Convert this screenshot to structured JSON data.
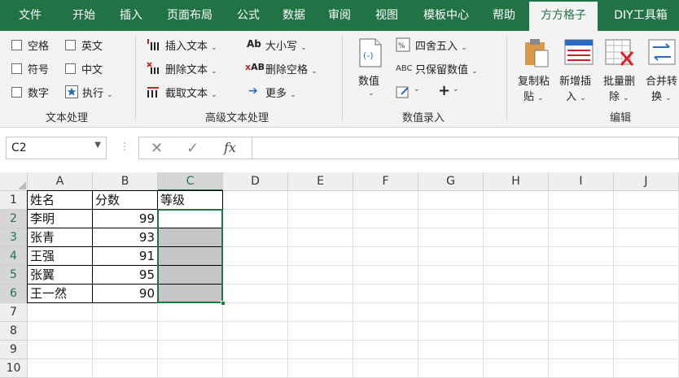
{
  "tabs": [
    {
      "label": "文件"
    },
    {
      "label": "开始"
    },
    {
      "label": "插入"
    },
    {
      "label": "页面布局"
    },
    {
      "label": "公式"
    },
    {
      "label": "数据"
    },
    {
      "label": "审阅"
    },
    {
      "label": "视图"
    },
    {
      "label": "模板中心"
    },
    {
      "label": "帮助"
    },
    {
      "label": "方方格子"
    },
    {
      "label": "DIY工具箱"
    }
  ],
  "ribbon": {
    "text_processing": {
      "group_label": "文本处理",
      "checks": [
        "空格",
        "英文",
        "符号",
        "中文",
        "数字"
      ],
      "execute": "执行"
    },
    "advanced_text": {
      "group_label": "高级文本处理",
      "insert": "插入文本",
      "delete": "删除文本",
      "extract": "截取文本",
      "case": "大小写",
      "delete_space": "删除空格",
      "more": "更多"
    },
    "numeric": {
      "group_label": "数值录入",
      "value": "数值",
      "round": "四舍五入",
      "keep_value": "只保留数值",
      "plus": "+"
    },
    "edit": {
      "group_label": "编辑",
      "copy_paste": [
        "复制粘",
        "贴"
      ],
      "add_insert": [
        "新增插",
        "入"
      ],
      "batch_delete": [
        "批量删",
        "除"
      ],
      "merge_convert": [
        "合并转",
        "换"
      ]
    }
  },
  "formula_bar": {
    "name_box": "C2",
    "fx": "fx",
    "content": ""
  },
  "sheet": {
    "columns": [
      "A",
      "B",
      "C",
      "D",
      "E",
      "F",
      "G",
      "H",
      "I",
      "J"
    ],
    "rows": [
      "1",
      "2",
      "3",
      "4",
      "5",
      "6",
      "7",
      "8",
      "9",
      "10"
    ],
    "header": [
      "姓名",
      "分数",
      "等级"
    ],
    "data": [
      {
        "name": "李明",
        "score": "99"
      },
      {
        "name": "张青",
        "score": "93"
      },
      {
        "name": "王强",
        "score": "91"
      },
      {
        "name": "张翼",
        "score": "95"
      },
      {
        "name": "王一然",
        "score": "90"
      }
    ]
  },
  "colors": {
    "accent": "#217346",
    "selection_fill": "#c6c6c6"
  }
}
